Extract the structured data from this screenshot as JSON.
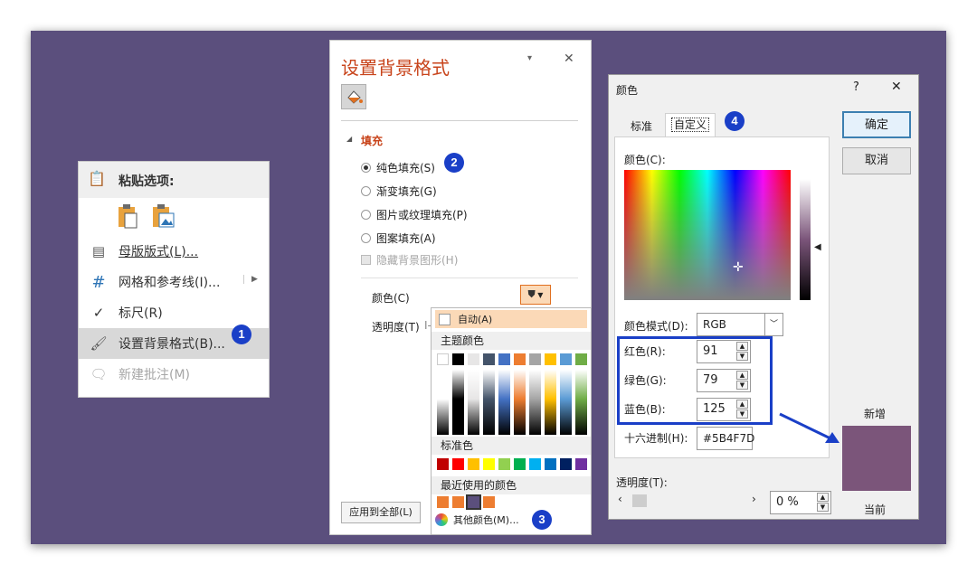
{
  "context_menu": {
    "paste_header": "粘贴选项:",
    "items": [
      {
        "label": "母版版式(L)..."
      },
      {
        "label": "网格和参考线(I)..."
      },
      {
        "label": "标尺(R)"
      },
      {
        "label": "设置背景格式(B)..."
      },
      {
        "label": "新建批注(M)"
      }
    ],
    "badge": "1"
  },
  "format_pane": {
    "title": "设置背景格式",
    "section": "填充",
    "options": [
      "纯色填充(S)",
      "渐变填充(G)",
      "图片或纹理填充(P)",
      "图案填充(A)"
    ],
    "hide_graphics": "隐藏背景图形(H)",
    "color_label": "颜色(C)",
    "transparency_label": "透明度(T)",
    "apply_all": "应用到全部(L)",
    "badge": "2"
  },
  "color_dropdown": {
    "auto": "自动(A)",
    "theme_colors": "主题颜色",
    "standard_colors": "标准色",
    "recent_colors": "最近使用的颜色",
    "more_colors": "其他颜色(M)...",
    "badge": "3",
    "theme_top": [
      "#ffffff",
      "#000000",
      "#e7e6e6",
      "#44546a",
      "#4472c4",
      "#ed7d31",
      "#a5a5a5",
      "#ffc000",
      "#5b9bd5",
      "#70ad47"
    ],
    "standard": [
      "#c00000",
      "#ff0000",
      "#ffc000",
      "#ffff00",
      "#92d050",
      "#00b050",
      "#00b0f0",
      "#0070c0",
      "#002060",
      "#7030a0"
    ],
    "recent": [
      "#ed7d31",
      "#ed7d31",
      "#5b4f7d",
      "#ed7d31"
    ]
  },
  "color_dialog": {
    "title": "颜色",
    "help": "?",
    "close": "✕",
    "tabs": [
      "标准",
      "自定义"
    ],
    "badge": "4",
    "colors_label": "颜色(C):",
    "mode_label": "颜色模式(D):",
    "mode_value": "RGB",
    "red_label": "红色(R):",
    "green_label": "绿色(G):",
    "blue_label": "蓝色(B):",
    "red": "91",
    "green": "79",
    "blue": "125",
    "hex_label": "十六进制(H):",
    "hex": "#5B4F7D",
    "transparency_label": "透明度(T):",
    "transparency": "0 %",
    "ok": "确定",
    "cancel": "取消",
    "new_label": "新增",
    "current_label": "当前",
    "new_color": "#7b557a"
  }
}
